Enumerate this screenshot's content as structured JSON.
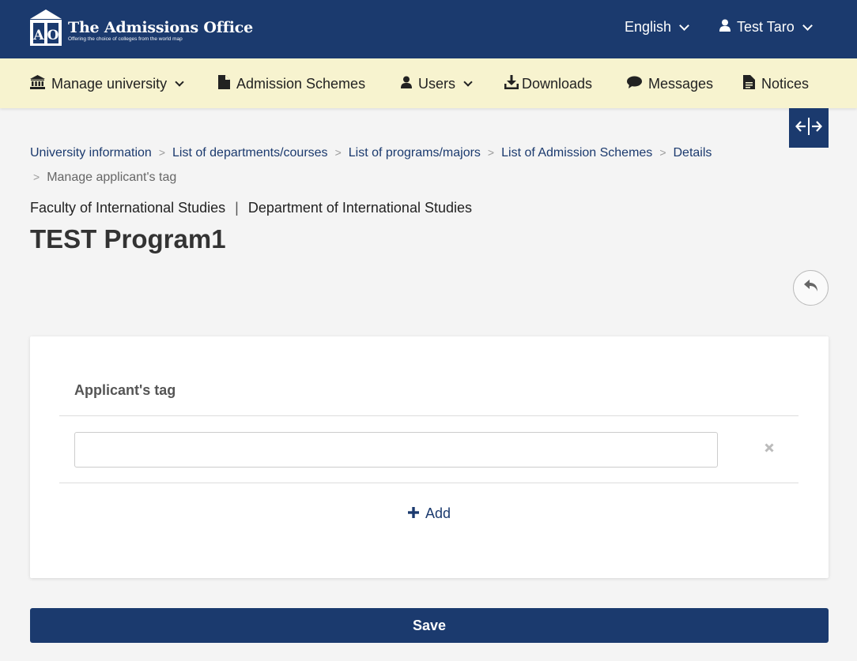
{
  "header": {
    "logo_title": "The Admissions Office",
    "logo_subtitle": "Offering the choice of colleges from the world map",
    "language": "English",
    "user_name": "Test Taro"
  },
  "menu": {
    "manage_university": "Manage university",
    "admission_schemes": "Admission Schemes",
    "users": "Users",
    "downloads": "Downloads",
    "messages": "Messages",
    "notices": "Notices"
  },
  "breadcrumb": {
    "items": [
      "University information",
      "List of departments/courses",
      "List of programs/majors",
      "List of Admission Schemes",
      "Details"
    ],
    "current": "Manage applicant's tag",
    "separator": ">"
  },
  "page": {
    "faculty": "Faculty of International Studies",
    "divider": "|",
    "department": "Department of International Studies",
    "title": "TEST Program1"
  },
  "card": {
    "header": "Applicant's tag",
    "tag_value": "",
    "add_label": "Add"
  },
  "save_label": "Save",
  "colors": {
    "primary": "#1b3a6e",
    "menu_bg": "#f7f3cf",
    "page_bg": "#f4f4f4"
  }
}
